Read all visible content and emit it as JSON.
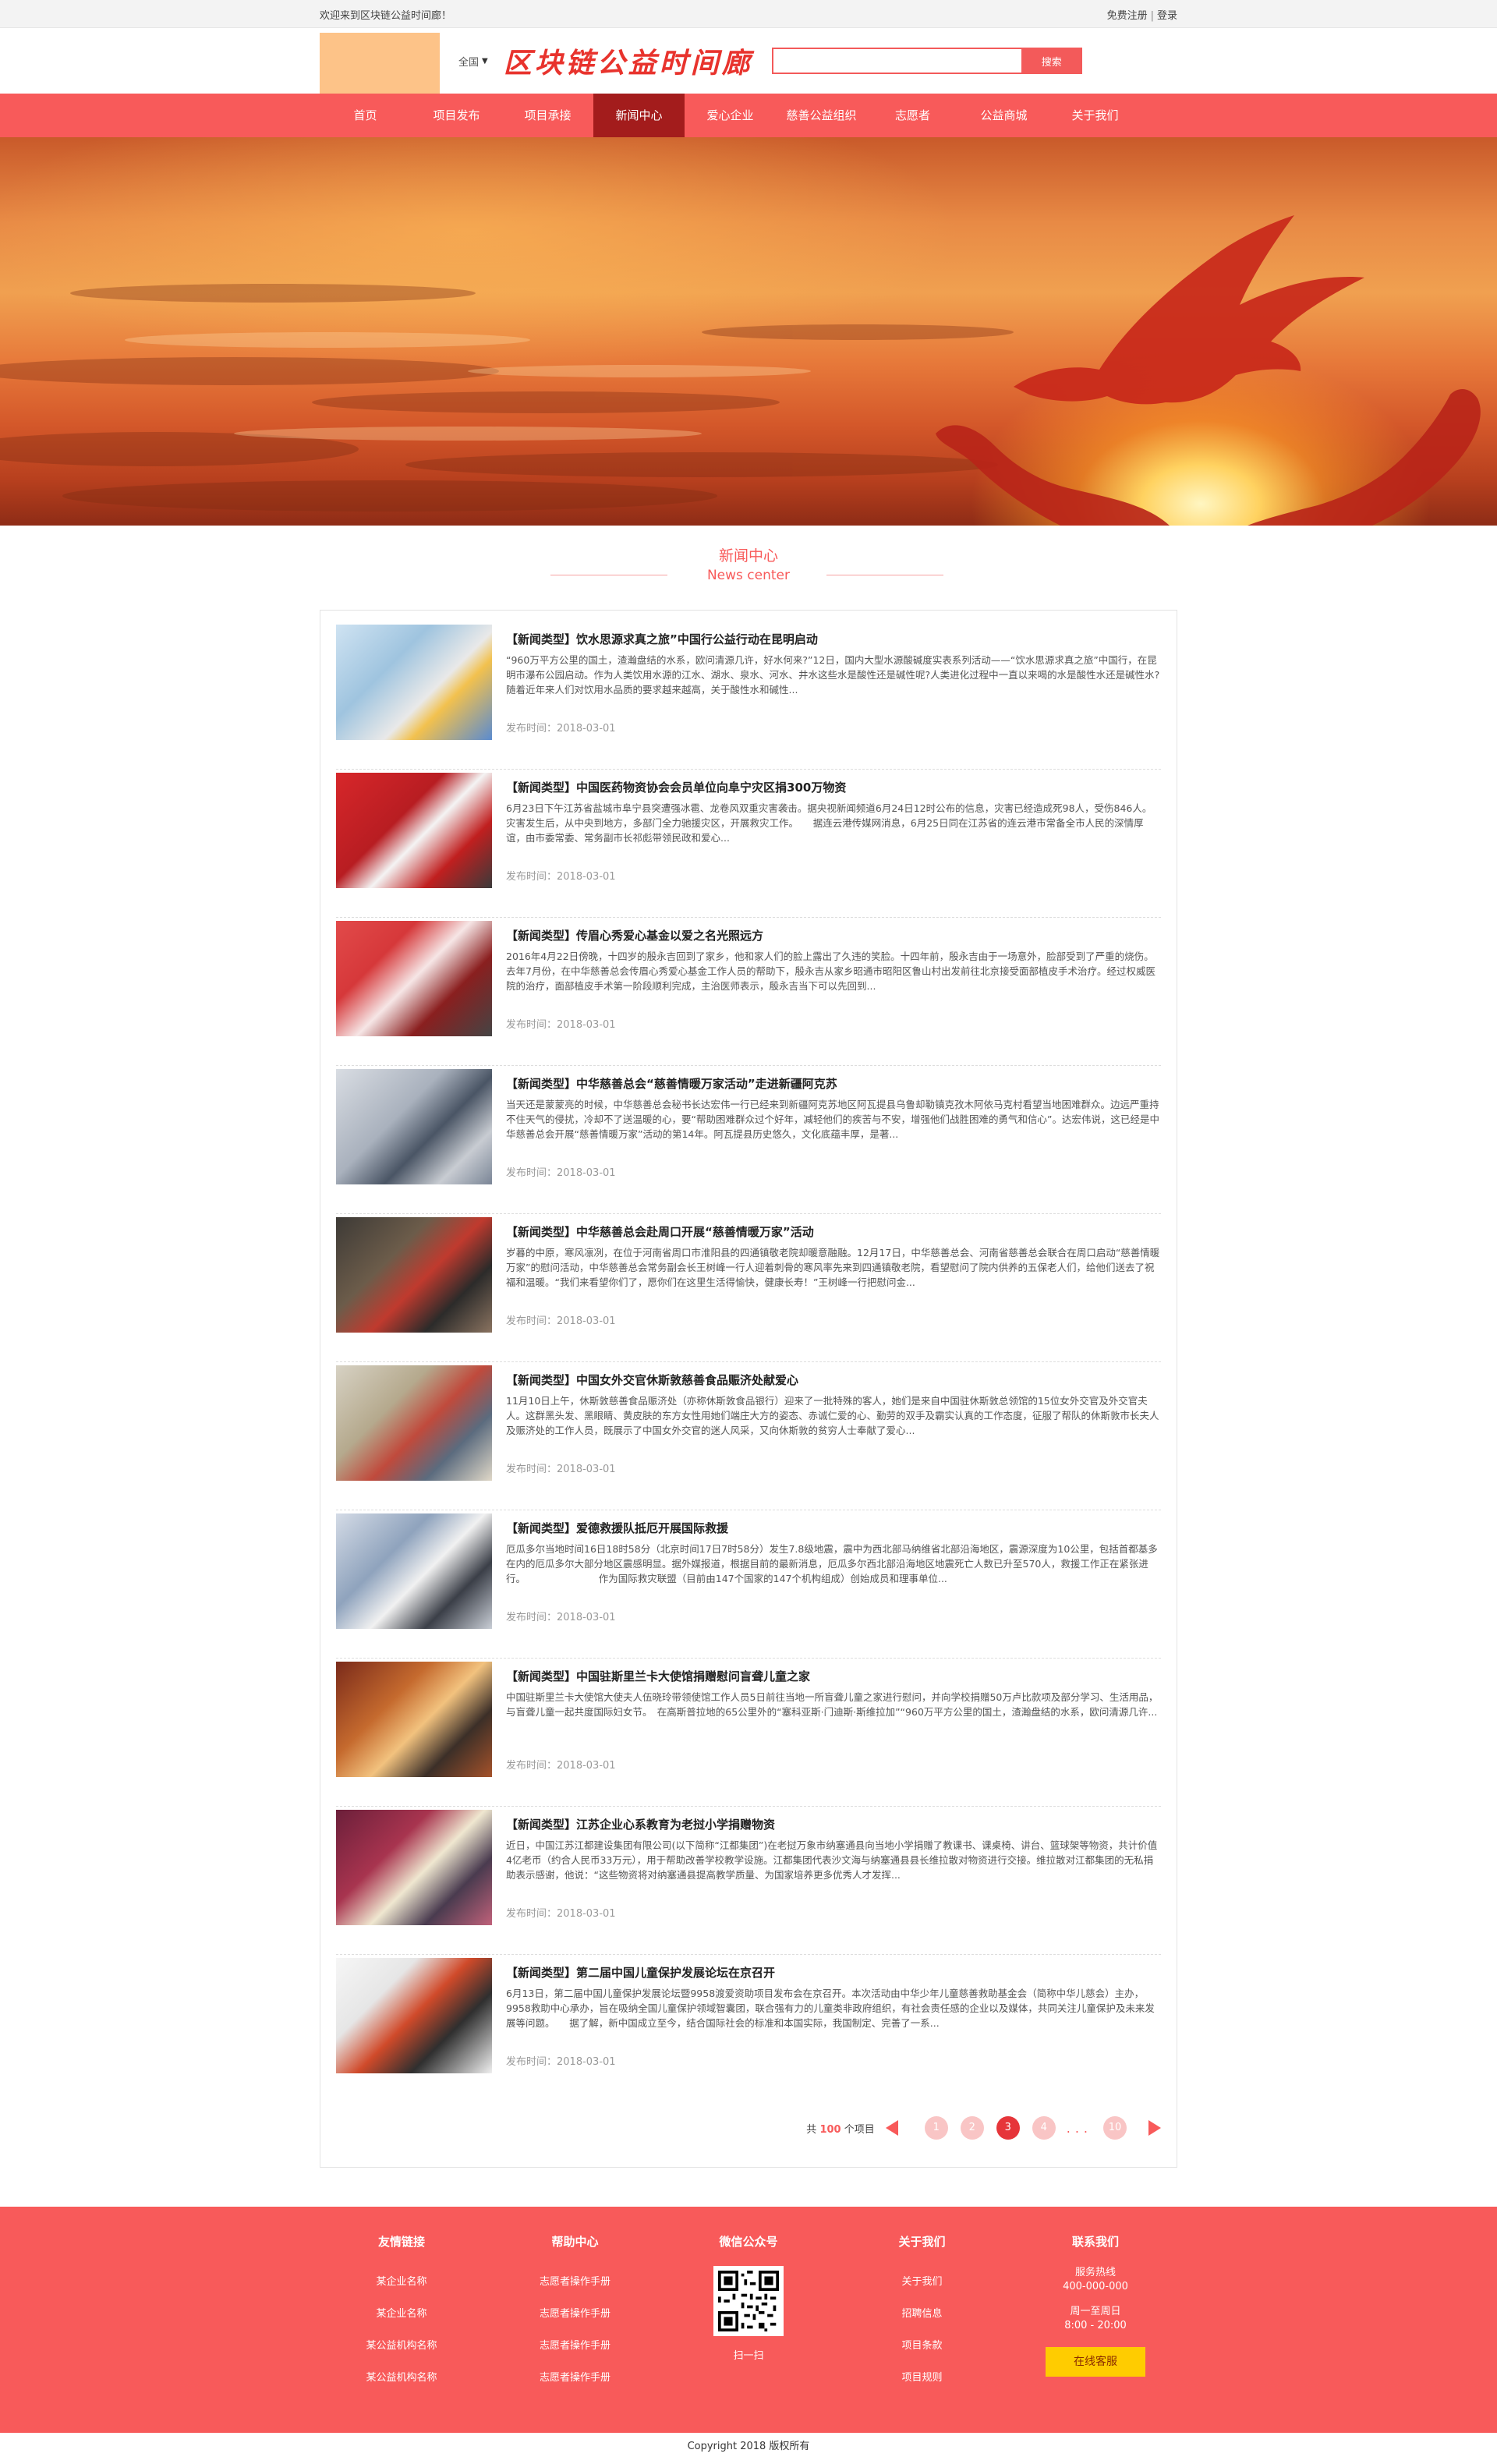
{
  "topbar": {
    "welcome": "欢迎来到区块链公益时间廊！",
    "register": "免费注册",
    "sep": "|",
    "login": "登录"
  },
  "header": {
    "region": "全国",
    "site_title": "区块链公益时间廊",
    "search_placeholder": "",
    "search_button": "搜索"
  },
  "nav": {
    "items": [
      "首页",
      "项目发布",
      "项目承接",
      "新闻中心",
      "爱心企业",
      "慈善公益组织",
      "志愿者",
      "公益商城",
      "关于我们"
    ],
    "active_index": 3
  },
  "section": {
    "title_zh": "新闻中心",
    "title_en": "News center"
  },
  "news": [
    {
      "title": "【新闻类型】饮水思源求真之旅”中国行公益行动在昆明启动",
      "summary": "“960万平方公里的国土，渣瀚盘结的水系，欧问清源几许，好水何来?”12日，国内大型水源酸碱度实表系列活动——“饮水思源求真之旅”中国行，在昆明市瀑布公园启动。作为人类饮用水源的江水、湖水、泉水、河水、井水这些水是酸性还是碱性呢?人类进化过程中一直以来喝的水是酸性水还是碱性水?随着近年来人们对饮用水品质的要求越来越高，关于酸性水和碱性...",
      "date": "发布时间：2018-03-01"
    },
    {
      "title": "【新闻类型】中国医药物资协会会员单位向阜宁灾区捐300万物资",
      "summary": "6月23日下午江苏省盐城市阜宁县突遭强冰雹、龙卷风双重灾害袭击。据央视新闻频道6月24日12时公布的信息，灾害已经造成死98人，受伤846人。灾害发生后，从中央到地方，多部门全力驰援灾区，开展救灾工作。　　据连云港传媒网消息，6月25日同在江苏省的连云港市常备全市人民的深情厚谊，由市委常委、常务副市长祁彪带领民政和爱心...",
      "date": "发布时间：2018-03-01"
    },
    {
      "title": "【新闻类型】传眉心秀爱心基金以爱之名光照远方",
      "summary": "2016年4月22日傍晚，十四岁的殷永吉回到了家乡，他和家人们的脸上露出了久违的笑脸。十四年前，殷永吉由于一场意外，脸部受到了严重的烧伤。去年7月份，在中华慈善总会传眉心秀爱心基金工作人员的帮助下，殷永吉从家乡昭通市昭阳区鲁山村出发前往北京接受面部植皮手术治疗。经过权威医院的治疗，面部植皮手术第一阶段顺利完成，主治医师表示，殷永吉当下可以先回到...",
      "date": "发布时间：2018-03-01"
    },
    {
      "title": "【新闻类型】中华慈善总会“慈善情暖万家活动”走进新疆阿克苏",
      "summary": "当天还是蒙蒙亮的时候，中华慈善总会秘书长达宏伟一行已经来到新疆阿克苏地区阿瓦提县乌鲁却勒镇克孜木阿依马克村看望当地困难群众。边远严重持不住天气的侵扰，冷却不了送温暖的心，要“帮助困难群众过个好年，减轻他们的疾苦与不安，增强他们战胜困难的勇气和信心”。达宏伟说，这已经是中华慈善总会开展“慈善情暖万家”活动的第14年。阿瓦提县历史悠久，文化底蕴丰厚，是著...",
      "date": "发布时间：2018-03-01"
    },
    {
      "title": "【新闻类型】中华慈善总会赴周口开展“慈善情暖万家”活动",
      "summary": "岁暮的中原，寒风凛冽，在位于河南省周口市淮阳县的四通镇敬老院却暖意融融。12月17日，中华慈善总会、河南省慈善总会联合在周口启动“慈善情暖万家”的慰问活动，中华慈善总会常务副会长王树峰一行人迎着刺骨的寒风率先来到四通镇敬老院，看望慰问了院内供养的五保老人们，给他们送去了祝福和温暖。“我们来看望你们了，愿你们在这里生活得愉快，健康长寿！”王树峰一行把慰问金...",
      "date": "发布时间：2018-03-01"
    },
    {
      "title": "【新闻类型】中国女外交官休斯敦慈善食品赈济处献爱心",
      "summary": "11月10日上午，休斯敦慈善食品赈济处（亦称休斯敦食品银行）迎来了一批特殊的客人，她们是来自中国驻休斯敦总领馆的15位女外交官及外交官夫人。这群黑头发、黑眼睛、黄皮肤的东方女性用她们端庄大方的姿态、赤诚仁爱的心、勤劳的双手及霸实认真的工作态度，征服了帮队的休斯敦市长夫人及赈济处的工作人员，既展示了中国女外交官的迷人风采，又向休斯敦的贫穷人士奉献了爱心...",
      "date": "发布时间：2018-03-01"
    },
    {
      "title": "【新闻类型】爱德救援队抵厄开展国际救援",
      "summary": "厄瓜多尔当地时间16日18时58分（北京时间17日7时58分）发生7.8级地震，震中为西北部马纳维省北部沿海地区，震源深度为10公里，包括首都基多在内的厄瓜多尔大部分地区震感明显。据外媒报道，根据目前的最新消息，厄瓜多尔西北部沿海地区地震死亡人数已升至570人，救援工作正在紧张进行。　　　　　　　　作为国际救灾联盟（目前由147个国家的147个机构组成）创始成员和理事单位...",
      "date": "发布时间：2018-03-01"
    },
    {
      "title": "【新闻类型】中国驻斯里兰卡大使馆捐赠慰问盲聋儿童之家",
      "summary": "中国驻斯里兰卡大使馆大使夫人伍晓玲带领使馆工作人员5日前往当地一所盲聋儿童之家进行慰问，并向学校捐赠50万卢比款项及部分学习、生活用品，与盲聋儿童一起共度国际妇女节。　在高斯普拉地的65公里外的“塞科亚斯·门迪斯·斯维拉加”“960万平方公里的国土，渣瀚盘结的水系，欧问清源几许...",
      "date": "发布时间：2018-03-01"
    },
    {
      "title": "【新闻类型】江苏企业心系教育为老挝小学捐赠物资",
      "summary": "近日，中国江苏江都建设集团有限公司(以下简称“江都集团”)在老挝万象市纳塞通县向当地小学捐赠了教课书、课桌椅、讲台、篮球架等物资，共计价值4亿老币（约合人民币33万元），用于帮助改善学校教学设施。江都集团代表沙文海与纳塞通县县长维拉散对物资进行交接。维拉散对江都集团的无私捐助表示感谢，他说：“这些物资将对纳塞通县提高教学质量、为国家培养更多优秀人才发挥...",
      "date": "发布时间：2018-03-01"
    },
    {
      "title": "【新闻类型】第二届中国儿童保护发展论坛在京召开",
      "summary": "6月13日，第二届中国儿童保护发展论坛暨9958渡爱资助项目发布会在京召开。本次活动由中华少年儿童慈善救助基金会（简称中华儿慈会）主办，9958救助中心承办，旨在吸纳全国儿童保护领域智囊团，联合强有力的儿童类非政府组织，有社会责任感的企业以及媒体，共同关注儿童保护及未来发展等问题。　　据了解，新中国成立至今，结合国际社会的标准和本国实际，我国制定、完善了一系...",
      "date": "发布时间：2018-03-01"
    }
  ],
  "pager": {
    "total_prefix": "共",
    "total_count": "100",
    "total_suffix": "个项目",
    "pages": [
      "1",
      "2",
      "3",
      "4"
    ],
    "current": "3",
    "dots": "...",
    "last": "10"
  },
  "footer": {
    "columns": [
      {
        "title": "友情链接",
        "items": [
          "某企业名称",
          "某企业名称",
          "某公益机构名称",
          "某公益机构名称"
        ]
      },
      {
        "title": "帮助中心",
        "items": [
          "志愿者操作手册",
          "志愿者操作手册",
          "志愿者操作手册",
          "志愿者操作手册"
        ]
      },
      {
        "title": "微信公众号",
        "qr_label": "扫一扫"
      },
      {
        "title": "关于我们",
        "items": [
          "关于我们",
          "招聘信息",
          "项目条款",
          "项目规则"
        ]
      },
      {
        "title": "联系我们",
        "hotline_label": "服务热线",
        "hotline": "400-000-000",
        "hours_label": "周一至周日",
        "hours": "8:00 - 20:00",
        "service_button": "在线客服"
      }
    ],
    "copyright": "Copyright 2018 版权所有"
  }
}
